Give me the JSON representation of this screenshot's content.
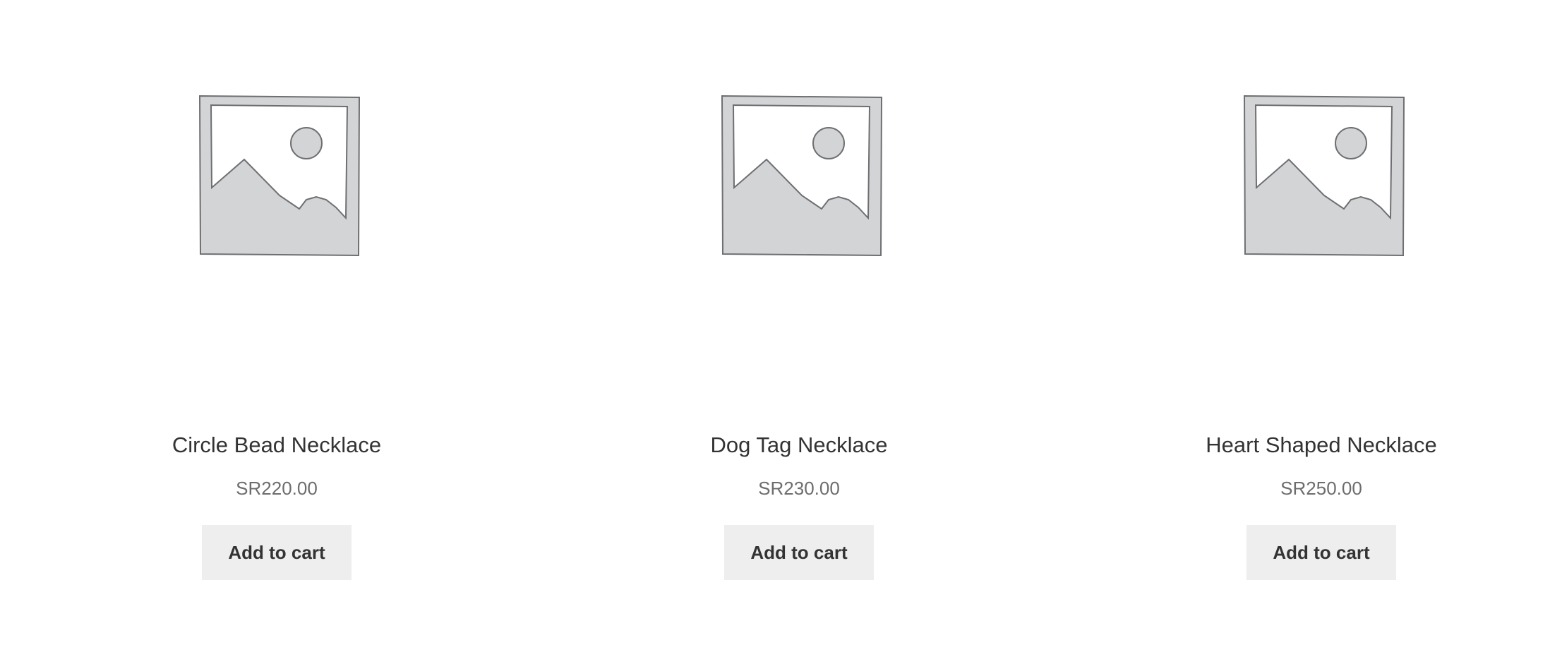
{
  "products": [
    {
      "name": "Circle Bead Necklace",
      "price": "SR220.00",
      "button_label": "Add to cart",
      "image": "placeholder-image-icon"
    },
    {
      "name": "Dog Tag Necklace",
      "price": "SR230.00",
      "button_label": "Add to cart",
      "image": "placeholder-image-icon"
    },
    {
      "name": "Heart Shaped Necklace",
      "price": "SR250.00",
      "button_label": "Add to cart",
      "image": "placeholder-image-icon"
    }
  ],
  "colors": {
    "placeholder_fill": "#d3d4d6",
    "placeholder_stroke": "#6e6f72",
    "button_bg": "#eeeeee",
    "title_text": "#333333",
    "price_text": "#6d6d6d"
  }
}
